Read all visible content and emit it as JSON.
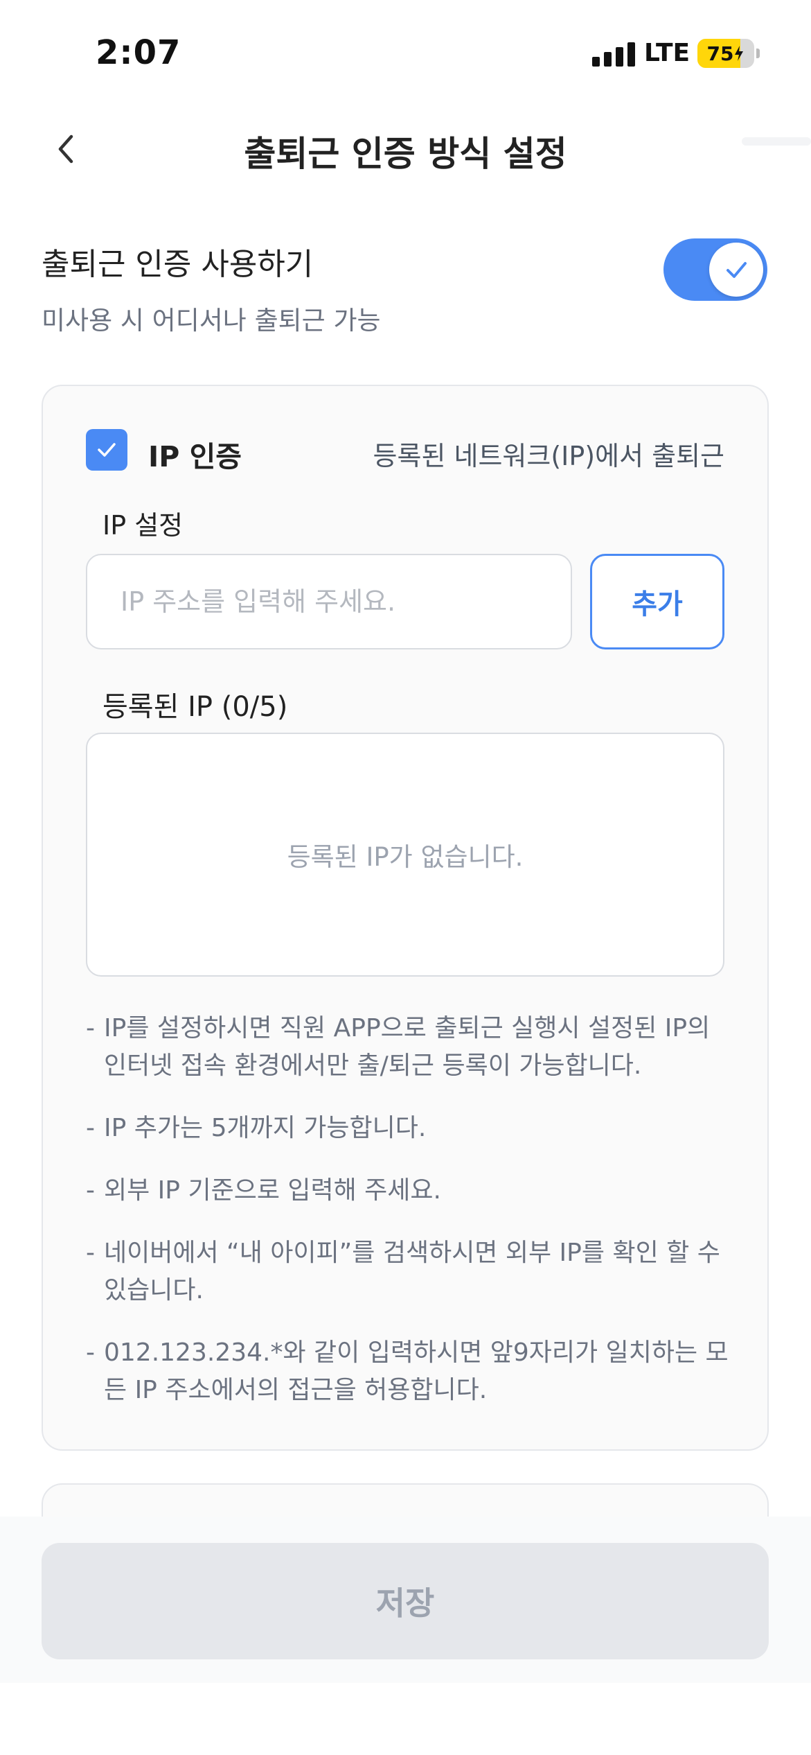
{
  "status_bar": {
    "time": "2:07",
    "network": "LTE",
    "battery": "75",
    "battery_level_percent": 75,
    "battery_color": "#ffd60a"
  },
  "header": {
    "title": "출퇴근 인증 방식 설정",
    "back_icon": "chevron-left-icon"
  },
  "auth_toggle": {
    "title": "출퇴근 인증 사용하기",
    "subtitle": "미사용 시 어디서나 출퇴근 가능",
    "enabled": true,
    "accent_color": "#4a8af4"
  },
  "ip_card": {
    "checkbox_checked": true,
    "label": "IP 인증",
    "description": "등록된 네트워크(IP)에서 출퇴근",
    "ip_setting_label": "IP 설정",
    "ip_input": {
      "value": "",
      "placeholder": "IP 주소를 입력해 주세요."
    },
    "add_button": "추가",
    "registered_label": "등록된 IP (0/5)",
    "empty_message": "등록된 IP가 없습니다.",
    "notes": [
      "IP를 설정하시면 직원 APP으로 출퇴근 실행시 설정된 IP의 인터넷 접속 환경에서만 출/퇴근 등록이 가능합니다.",
      "IP 추가는 5개까지 가능합니다.",
      "외부 IP 기준으로 입력해 주세요.",
      "네이버에서 “내 아이피”를 검색하시면 외부 IP를 확인 할 수 있습니다.",
      "012.123.234.*와 같이 입력하시면 앞9자리가 일치하는 모든 IP 주소에서의 접근을 허용합니다."
    ],
    "note_prefix": "-"
  },
  "footer": {
    "save_button": "저장"
  }
}
